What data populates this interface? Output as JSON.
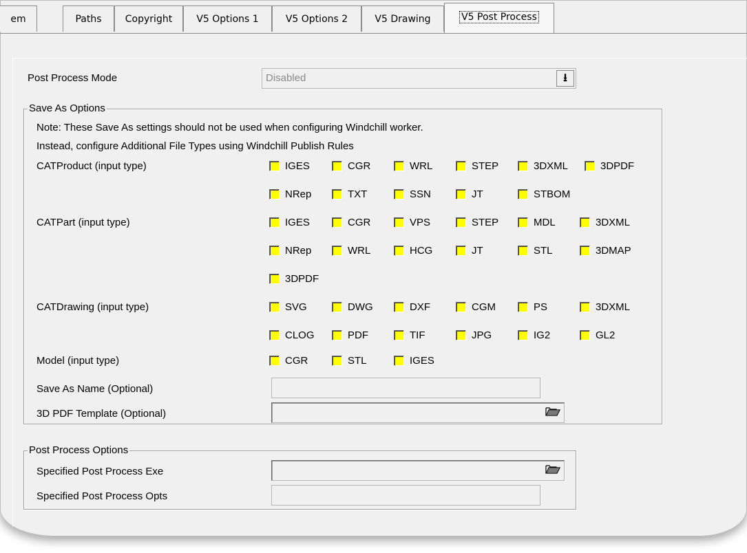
{
  "tabs": [
    {
      "label": "em"
    },
    {
      "label": "Paths"
    },
    {
      "label": "Copyright"
    },
    {
      "label": "V5 Options 1"
    },
    {
      "label": "V5 Options 2"
    },
    {
      "label": "V5 Drawing"
    },
    {
      "label": "V5 Post Process"
    }
  ],
  "post_process_mode": {
    "label": "Post Process Mode",
    "value": "Disabled",
    "dropdown_glyph": "⭳"
  },
  "save_as": {
    "title": "Save As Options",
    "note1": "Note: These Save As settings should not be used when configuring Windchill worker.",
    "note2": "Instead, configure Additional File Types using Windchill Publish Rules",
    "catproduct": {
      "label": "CATProduct (input type)",
      "options": [
        "IGES",
        "CGR",
        "WRL",
        "STEP",
        "3DXML",
        "3DPDF",
        "NRep",
        "TXT",
        "SSN",
        "JT",
        "STBOM"
      ]
    },
    "catpart": {
      "label": "CATPart (input type)",
      "options": [
        "IGES",
        "CGR",
        "VPS",
        "STEP",
        "MDL",
        "3DXML",
        "NRep",
        "WRL",
        "HCG",
        "JT",
        "STL",
        "3DMAP",
        "3DPDF"
      ]
    },
    "catdrawing": {
      "label": "CATDrawing (input type)",
      "options": [
        "SVG",
        "DWG",
        "DXF",
        "CGM",
        "PS",
        "3DXML",
        "CLOG",
        "PDF",
        "TIF",
        "JPG",
        "IG2",
        "GL2"
      ]
    },
    "model": {
      "label": "Model (input type)",
      "options": [
        "CGR",
        "STL",
        "IGES"
      ]
    },
    "save_as_name": {
      "label": "Save As Name (Optional)",
      "value": ""
    },
    "pdf_template": {
      "label": "3D PDF Template (Optional)",
      "value": "",
      "browse_icon": "folder-open-icon"
    }
  },
  "post_process": {
    "title": "Post Process Options",
    "exe": {
      "label": "Specified Post Process Exe",
      "value": "",
      "browse_icon": "folder-open-icon"
    },
    "opts": {
      "label": "Specified Post Process Opts",
      "value": ""
    }
  },
  "colors": {
    "checkbox_fill": "#ffff00",
    "panel_bg": "#f0f0f0"
  }
}
